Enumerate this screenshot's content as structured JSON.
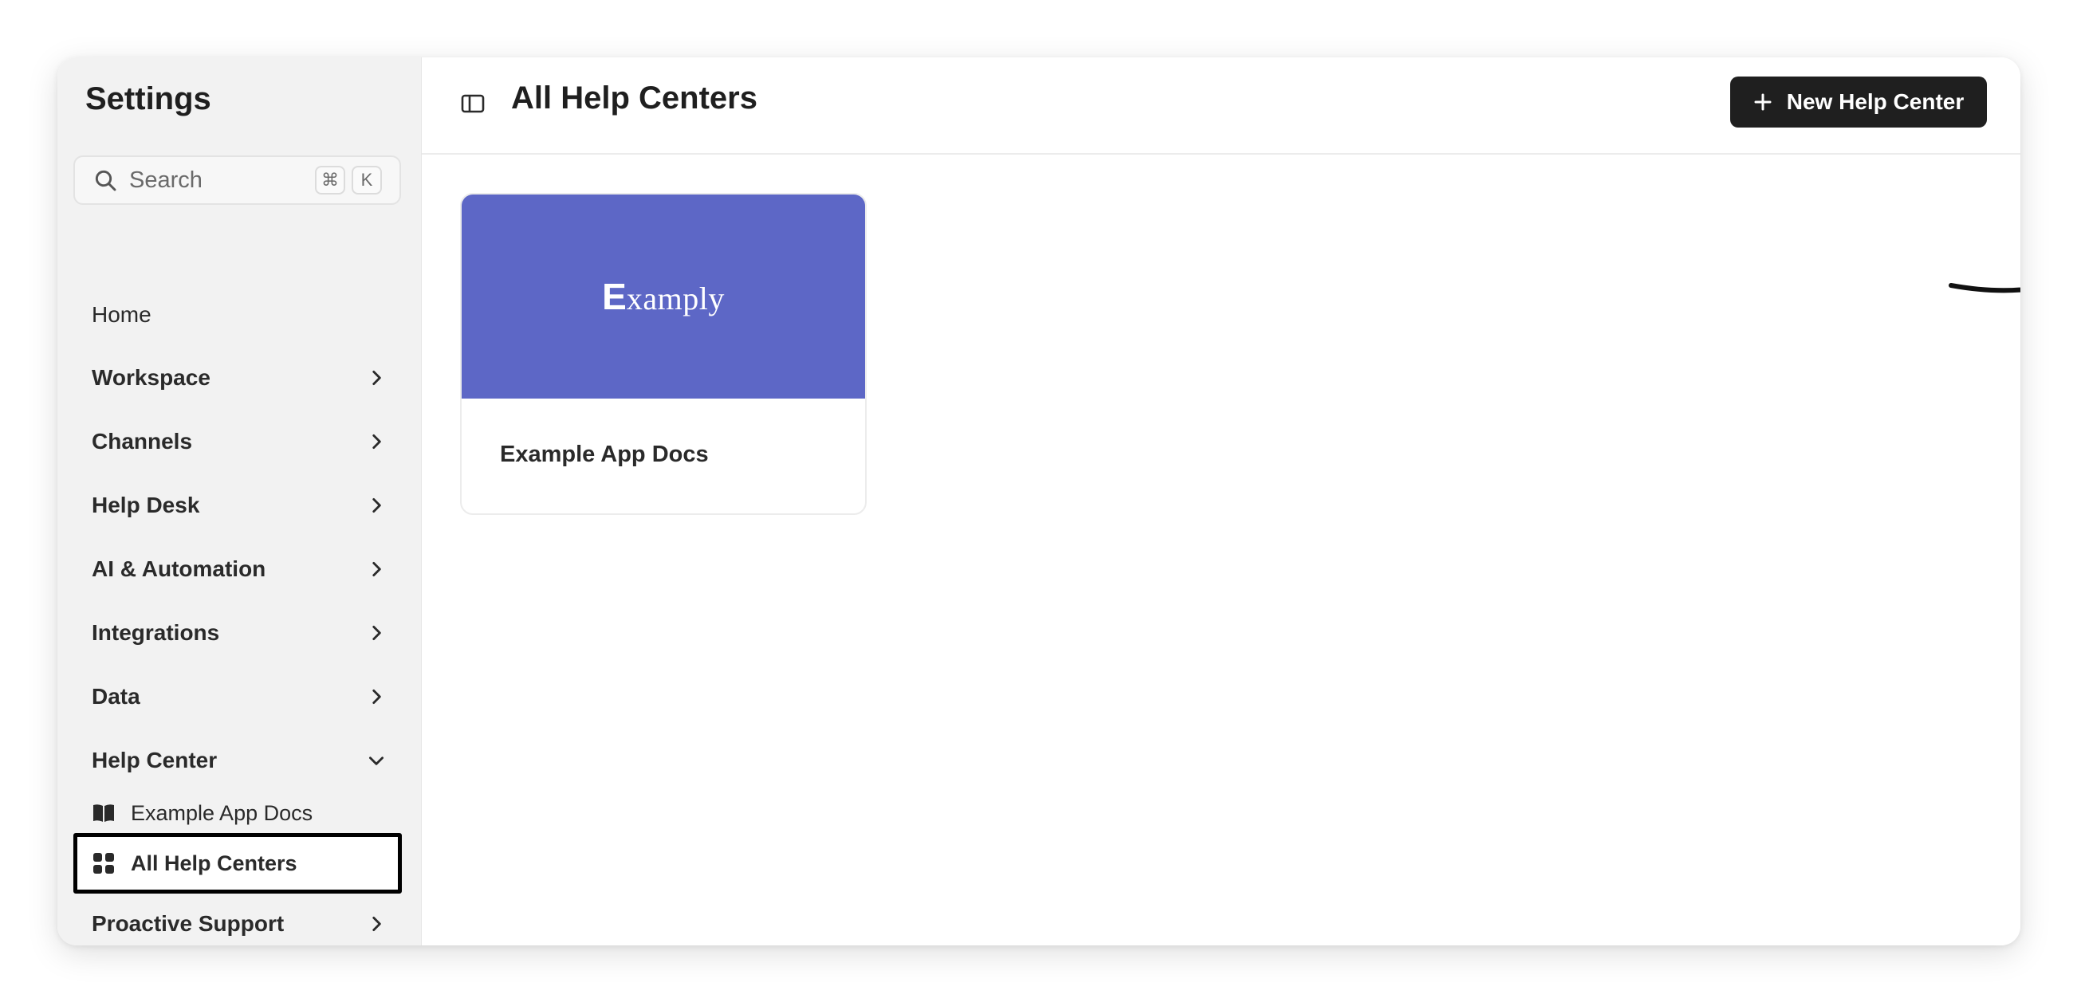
{
  "sidebar": {
    "title": "Settings",
    "search": {
      "placeholder": "Search",
      "shortcut_keys": [
        "⌘",
        "K"
      ]
    },
    "items": [
      {
        "label": "Home",
        "icon": "none"
      },
      {
        "label": "Workspace",
        "icon": "chevron-right-icon"
      },
      {
        "label": "Channels",
        "icon": "chevron-right-icon"
      },
      {
        "label": "Help Desk",
        "icon": "chevron-right-icon"
      },
      {
        "label": "AI & Automation",
        "icon": "chevron-right-icon"
      },
      {
        "label": "Integrations",
        "icon": "chevron-right-icon"
      },
      {
        "label": "Data",
        "icon": "chevron-right-icon"
      },
      {
        "label": "Help Center",
        "icon": "chevron-down-icon",
        "expanded": true
      },
      {
        "label": "Proactive Support",
        "icon": "chevron-right-icon"
      }
    ],
    "help_center_children": [
      {
        "label": "Example App Docs",
        "icon": "book-icon"
      },
      {
        "label": "All Help Centers",
        "icon": "grid-icon",
        "selected": true
      }
    ]
  },
  "header": {
    "title": "All Help Centers",
    "new_button_label": "New Help Center"
  },
  "cards": [
    {
      "title": "Example App Docs",
      "logo_initial": "E",
      "logo_rest": "xamply",
      "banner_color": "#5d67c6"
    }
  ],
  "colors": {
    "sidebar_bg": "#f2f2f2",
    "primary_button": "#1f1f1f",
    "card_banner": "#5d67c6"
  }
}
